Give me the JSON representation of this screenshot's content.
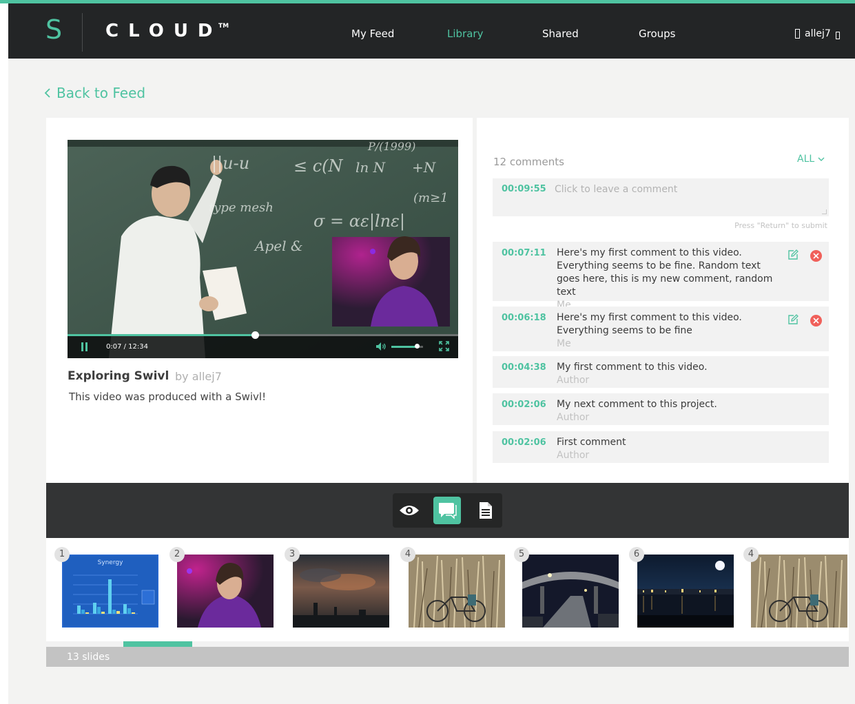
{
  "brand": {
    "letter": "S",
    "wordmark": "CLOUD",
    "trademark": "TM",
    "color": "#4fc3a1"
  },
  "nav": {
    "items": [
      {
        "label": "My Feed",
        "active": false
      },
      {
        "label": "Library",
        "active": true
      },
      {
        "label": "Shared",
        "active": false
      },
      {
        "label": "Groups",
        "active": false
      }
    ],
    "user": {
      "name": "allej7",
      "icon": "user-icon",
      "menu_icon": "dropdown-icon"
    }
  },
  "back_link": {
    "label": "Back to Feed",
    "icon": "chevron-left-icon"
  },
  "video": {
    "title": "Exploring Swivl",
    "author": "by allej7",
    "description": "This video was produced with a Swivl!",
    "time_display": "0:07 / 12:34",
    "progress": 0.48,
    "volume": 0.8,
    "board_lines": [
      "||u-u",
      "≤ c(N",
      "ln N",
      "+N",
      "type mesh",
      "σ = αε|lnε|",
      "Apel &",
      "(m≥1",
      "P/(1999)"
    ]
  },
  "comments": {
    "count_label": "12 comments",
    "filter_label": "ALL",
    "input": {
      "time": "00:09:55",
      "placeholder": "Click to leave a comment"
    },
    "submit_hint": "Press \"Return\" to submit",
    "items": [
      {
        "time": "00:07:11",
        "text": "Here's my first comment to this video. Everything seems to be fine. Random text goes here, this is my new comment, random text",
        "author": "Me",
        "editable": true
      },
      {
        "time": "00:06:18",
        "text": "Here's my first comment to this video. Everything seems to be fine",
        "author": "Me",
        "editable": true
      },
      {
        "time": "00:04:38",
        "text": "My first comment to this video.",
        "author": "Author",
        "editable": false
      },
      {
        "time": "00:02:06",
        "text": "My next comment to this project.",
        "author": "Author",
        "editable": false
      },
      {
        "time": "00:02:06",
        "text": "First comment",
        "author": "Author",
        "editable": false
      }
    ]
  },
  "modes": [
    {
      "name": "view-mode",
      "icon": "eye-icon",
      "active": false
    },
    {
      "name": "comments-mode",
      "icon": "chat-icon",
      "active": true
    },
    {
      "name": "notes-mode",
      "icon": "document-icon",
      "active": false
    }
  ],
  "slides": {
    "items": [
      {
        "number": "1",
        "kind": "chart",
        "title": "Synergy"
      },
      {
        "number": "2",
        "kind": "speaker"
      },
      {
        "number": "3",
        "kind": "clouds"
      },
      {
        "number": "4",
        "kind": "bicycle"
      },
      {
        "number": "5",
        "kind": "bridge"
      },
      {
        "number": "6",
        "kind": "night-city"
      },
      {
        "number": "4",
        "kind": "bicycle"
      }
    ],
    "count_label": "13 slides",
    "scroll_position": 0.1
  }
}
